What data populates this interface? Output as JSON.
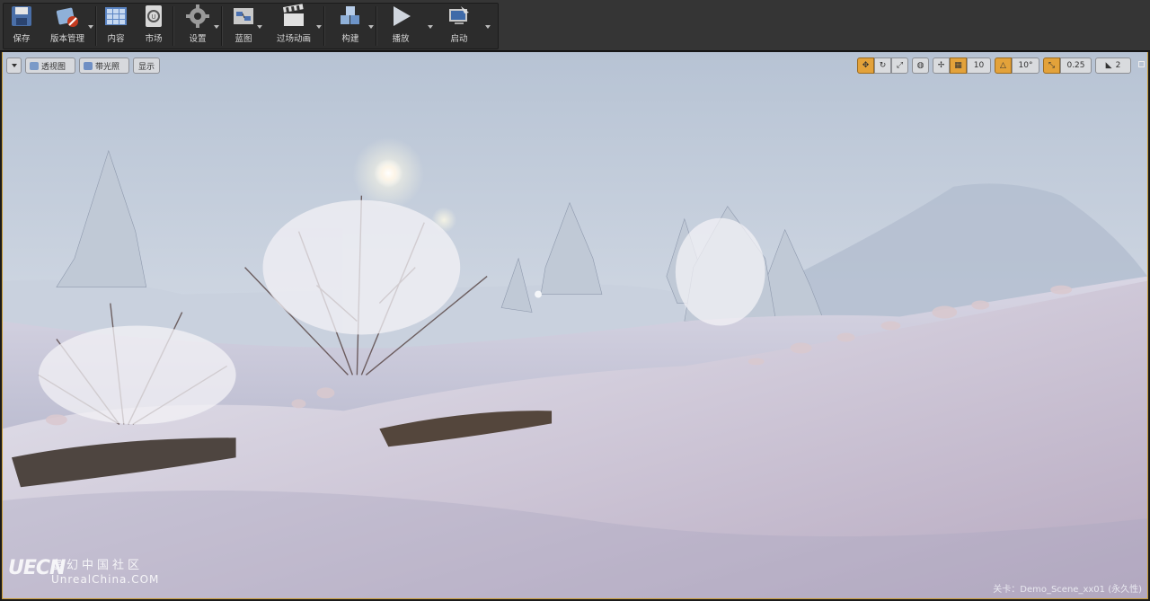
{
  "toolbar": {
    "save": "保存",
    "source_control": "版本管理",
    "content": "内容",
    "marketplace": "市场",
    "settings": "设置",
    "blueprints": "蓝图",
    "cinematics": "过场动画",
    "build": "构建",
    "play": "播放",
    "launch": "启动"
  },
  "viewport": {
    "perspective": "透视图",
    "lit": "带光照",
    "show": "显示",
    "grid_snap": "10",
    "rotation_snap": "10°",
    "scale_snap": "0.25",
    "camera_speed": "2",
    "level_label": "关卡：Demo_Scene_xx01 (永久性)"
  },
  "watermark": {
    "logo": "UECN",
    "name_cn": "虚幻中国社区",
    "name_en": "UnrealChina.COM"
  },
  "colors": {
    "toolbar_bg": "#353535",
    "accent_orange": "#e3a23a",
    "viewport_border": "#c79a35"
  }
}
